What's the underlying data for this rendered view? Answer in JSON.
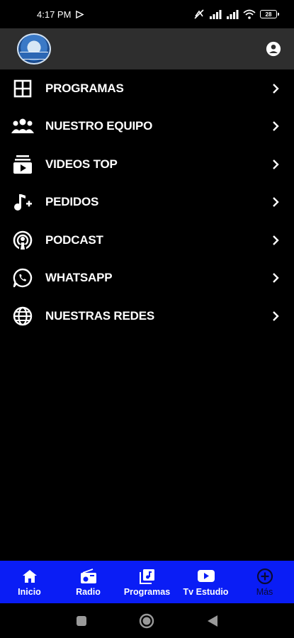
{
  "status_bar": {
    "time": "4:17 PM",
    "battery": "28"
  },
  "header": {
    "logo_icon": "station-logo",
    "account_icon": "account-circle-icon"
  },
  "menu": {
    "items": [
      {
        "label": "PROGRAMAS",
        "icon": "grid-icon"
      },
      {
        "label": "NUESTRO EQUIPO",
        "icon": "team-icon"
      },
      {
        "label": "VIDEOS TOP",
        "icon": "video-library-icon"
      },
      {
        "label": "PEDIDOS",
        "icon": "music-add-icon"
      },
      {
        "label": "PODCAST",
        "icon": "podcast-icon"
      },
      {
        "label": "WHATSAPP",
        "icon": "whatsapp-icon"
      },
      {
        "label": "NUESTRAS REDES",
        "icon": "globe-icon"
      }
    ]
  },
  "bottom_nav": {
    "items": [
      {
        "label": "Inicio",
        "icon": "home-icon"
      },
      {
        "label": "Radio",
        "icon": "radio-icon"
      },
      {
        "label": "Programas",
        "icon": "library-music-icon"
      },
      {
        "label": "Tv Estudio",
        "icon": "youtube-icon"
      },
      {
        "label": "Más",
        "icon": "plus-circle-icon"
      }
    ],
    "active_index": 4,
    "background": "#0a1df5"
  }
}
